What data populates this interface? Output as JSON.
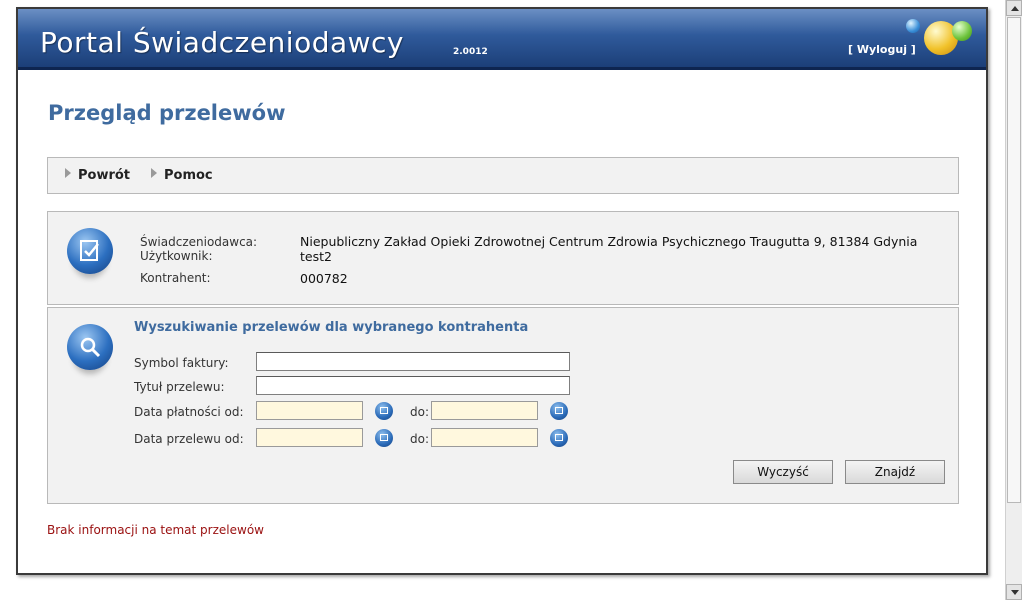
{
  "header": {
    "title": "Portal Świadczeniodawcy",
    "version": "2.0012",
    "logout_label": "[ Wyloguj ]"
  },
  "page_title": "Przegląd przelewów",
  "nav": {
    "items": [
      {
        "label": "Powrót",
        "icon": "triangle-right-icon"
      },
      {
        "label": "Pomoc",
        "icon": "triangle-right-icon"
      }
    ]
  },
  "info": {
    "icon": "checklist-icon",
    "provider_label": "Świadczeniodawca:",
    "provider_value": "Niepubliczny Zakład Opieki Zdrowotnej Centrum Zdrowia Psychicznego Traugutta 9, 81384 Gdynia",
    "user_label": "Użytkownik:",
    "user_value": "test2",
    "contractor_label": "Kontrahent:",
    "contractor_value": "000782"
  },
  "search": {
    "icon": "magnifier-icon",
    "heading": "Wyszukiwanie przelewów dla wybranego kontrahenta",
    "invoice_label": "Symbol faktury:",
    "invoice_value": "",
    "title_label": "Tytuł przelewu:",
    "title_value": "",
    "payment_date_label": "Data płatności od:",
    "transfer_date_label": "Data przelewu od:",
    "to_label": "do:",
    "clear_button": "Wyczyść",
    "find_button": "Znajdź"
  },
  "message": "Brak informacji na temat przelewów",
  "colors": {
    "header_dark": "#1c3f78",
    "title_blue": "#3f6b9f",
    "date_field_bg": "#fff8de",
    "message_red": "#9a1010"
  }
}
